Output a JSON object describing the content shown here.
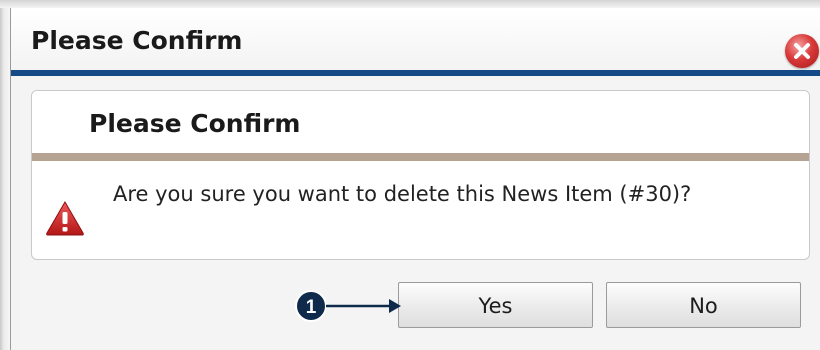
{
  "dialog": {
    "title": "Please Confirm",
    "close_icon": "close-icon"
  },
  "content": {
    "heading": "Please Confirm",
    "warning_icon": "warning-icon",
    "message": "Are you sure you want to delete this News Item (#30)?"
  },
  "buttons": {
    "yes_label": "Yes",
    "no_label": "No"
  },
  "callout": {
    "number": "1",
    "arrow_icon": "arrow-right-icon"
  },
  "colors": {
    "title_rule": "#164a86",
    "content_rule": "#b5a493",
    "close_red": "#d93a3a",
    "callout_badge": "#0f2a4a"
  }
}
